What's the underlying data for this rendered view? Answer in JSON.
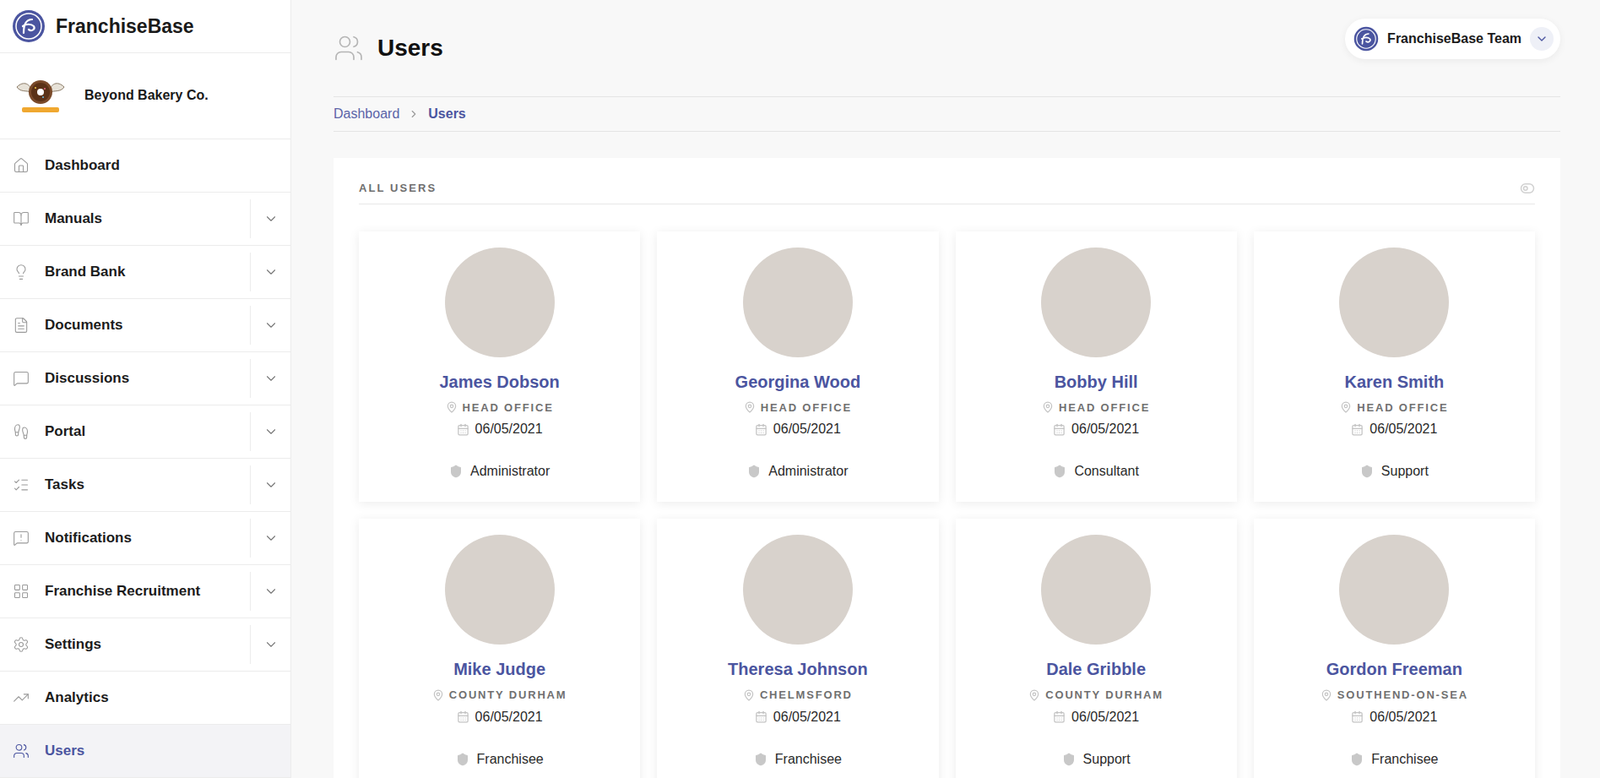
{
  "brand": {
    "name": "FranchiseBase"
  },
  "company": {
    "name": "Beyond Bakery Co."
  },
  "sidebar": {
    "items": [
      {
        "label": "Dashboard",
        "expandable": false,
        "selected": false
      },
      {
        "label": "Manuals",
        "expandable": true,
        "selected": false
      },
      {
        "label": "Brand Bank",
        "expandable": true,
        "selected": false
      },
      {
        "label": "Documents",
        "expandable": true,
        "selected": false
      },
      {
        "label": "Discussions",
        "expandable": true,
        "selected": false
      },
      {
        "label": "Portal",
        "expandable": true,
        "selected": false
      },
      {
        "label": "Tasks",
        "expandable": true,
        "selected": false
      },
      {
        "label": "Notifications",
        "expandable": true,
        "selected": false
      },
      {
        "label": "Franchise Recruitment",
        "expandable": true,
        "selected": false
      },
      {
        "label": "Settings",
        "expandable": true,
        "selected": false
      },
      {
        "label": "Analytics",
        "expandable": false,
        "selected": false
      },
      {
        "label": "Users",
        "expandable": false,
        "selected": true
      }
    ]
  },
  "header": {
    "title": "Users",
    "team": "FranchiseBase Team"
  },
  "breadcrumb": [
    {
      "label": "Dashboard",
      "selected": false
    },
    {
      "label": "Users",
      "selected": true
    }
  ],
  "panel": {
    "title": "ALL USERS"
  },
  "users": [
    {
      "name": "James Dobson",
      "location": "HEAD OFFICE",
      "date": "06/05/2021",
      "role": "Administrator"
    },
    {
      "name": "Georgina Wood",
      "location": "HEAD OFFICE",
      "date": "06/05/2021",
      "role": "Administrator"
    },
    {
      "name": "Bobby Hill",
      "location": "HEAD OFFICE",
      "date": "06/05/2021",
      "role": "Consultant"
    },
    {
      "name": "Karen Smith",
      "location": "HEAD OFFICE",
      "date": "06/05/2021",
      "role": "Support"
    },
    {
      "name": "Mike Judge",
      "location": "COUNTY DURHAM",
      "date": "06/05/2021",
      "role": "Franchisee"
    },
    {
      "name": "Theresa Johnson",
      "location": "CHELMSFORD",
      "date": "06/05/2021",
      "role": "Franchisee"
    },
    {
      "name": "Dale Gribble",
      "location": "COUNTY DURHAM",
      "date": "06/05/2021",
      "role": "Support"
    },
    {
      "name": "Gordon Freeman",
      "location": "SOUTHEND-ON-SEA",
      "date": "06/05/2021",
      "role": "Franchisee"
    }
  ]
}
